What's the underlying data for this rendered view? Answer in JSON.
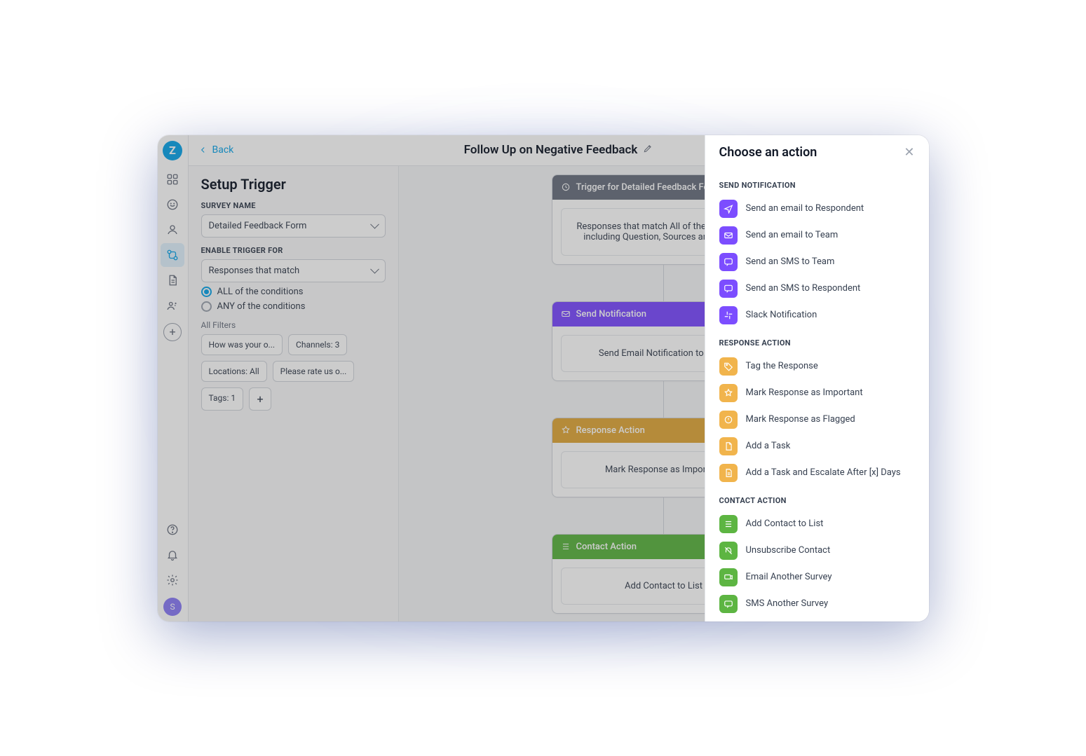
{
  "header": {
    "back_label": "Back",
    "title": "Follow Up on Negative Feedback"
  },
  "setup": {
    "heading": "Setup Trigger",
    "survey_label": "SURVEY NAME",
    "survey_value": "Detailed Feedback Form",
    "enable_label": "ENABLE TRIGGER FOR",
    "enable_value": "Responses that match",
    "radio_all": "ALL of the conditions",
    "radio_any": "ANY of the conditions",
    "selected_condition": "all",
    "filters_label": "All Filters",
    "chips": {
      "q": "How was your o...",
      "channels": "Channels: 3",
      "locations": "Locations: All",
      "rate": "Please rate us o...",
      "tags": "Tags: 1"
    }
  },
  "canvas": {
    "trigger": {
      "head": "Trigger for Detailed Feedback Form",
      "body": "Responses that match All of the conditions including Question, Sources and more..."
    },
    "notify": {
      "head": "Send Notification",
      "body": "Send Email Notification to Team"
    },
    "response": {
      "head": "Response Action",
      "body": "Mark Response as Important"
    },
    "contact": {
      "head": "Contact Action",
      "body": "Add Contact to List"
    }
  },
  "panel": {
    "title": "Choose an action",
    "sections": {
      "send_notification": {
        "title": "SEND NOTIFICATION",
        "items": {
          "email_respondent": "Send an email to Respondent",
          "email_team": "Send an email to Team",
          "sms_team": "Send an SMS to Team",
          "sms_respondent": "Send an SMS to Respondent",
          "slack": "Slack Notification"
        }
      },
      "response_action": {
        "title": "RESPONSE ACTION",
        "items": {
          "tag": "Tag the Response",
          "important": "Mark Response as Important",
          "flagged": "Mark Response as Flagged",
          "task": "Add a Task",
          "escalate": "Add a Task and Escalate After [x] Days"
        }
      },
      "contact_action": {
        "title": "CONTACT ACTION",
        "items": {
          "add_list": "Add Contact to List",
          "unsubscribe": "Unsubscribe Contact",
          "email_survey": "Email Another Survey",
          "sms_survey": "SMS Another Survey"
        }
      }
    }
  },
  "vnav": {
    "avatar_initial": "S"
  }
}
